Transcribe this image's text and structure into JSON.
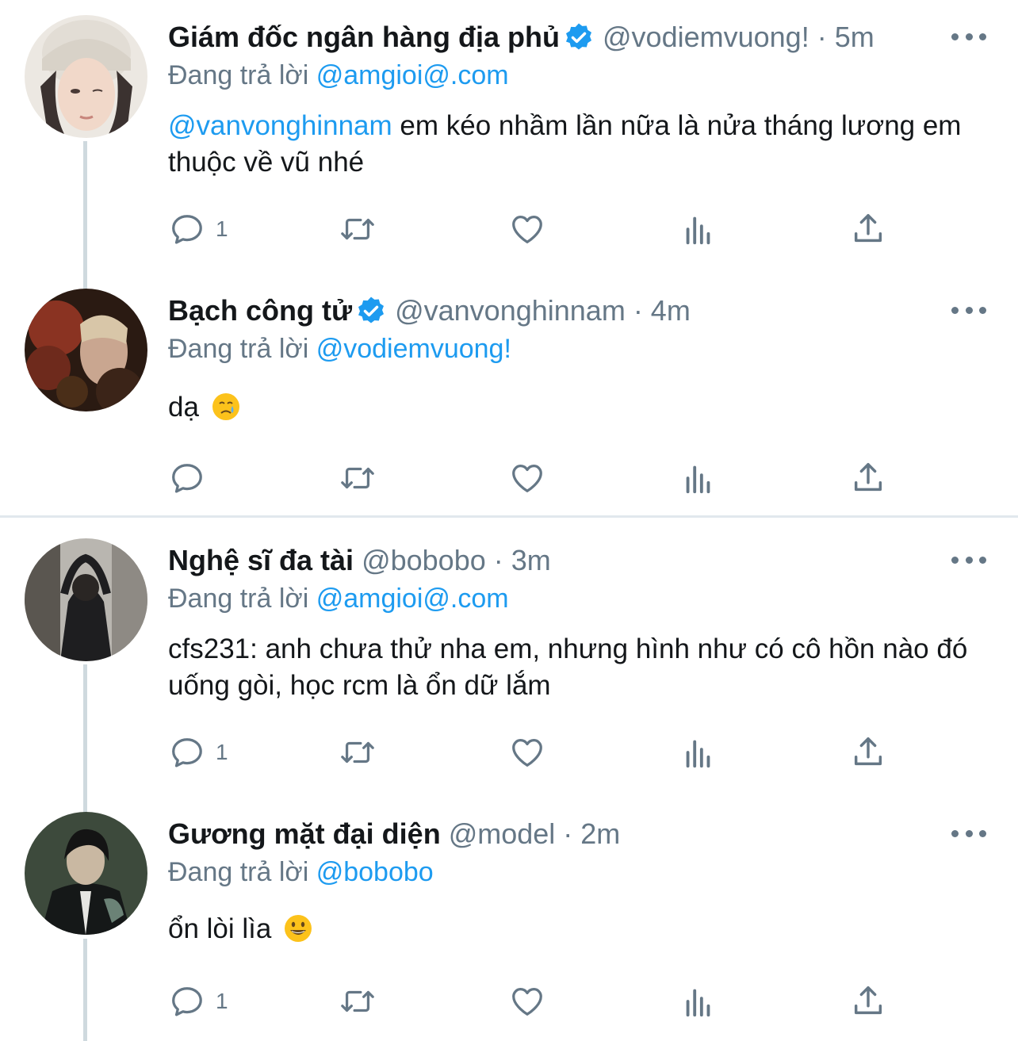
{
  "colors": {
    "accent": "#1d9bf0",
    "secondary_text": "#657786",
    "divider": "#e1e8ed",
    "thread_line": "#cfd9de"
  },
  "tweets": [
    {
      "name": "Giám đốc ngân hàng địa phủ",
      "handle": "@vodiemvuong! · 5m",
      "reply_prefix": "Đang trả lời ",
      "reply_to": "@amgioi@.com",
      "mention": "@vanvonghinnam",
      "text": " em kéo nhầm lần nữa là nửa tháng lương em thuộc về vũ nhé",
      "reply_count": "1"
    },
    {
      "name": "Bạch công tử",
      "handle": "@vanvonghinnam · 4m",
      "reply_prefix": "Đang trả lời ",
      "reply_to": "@vodiemvuong!",
      "text": "dạ",
      "emoji": "crying-face-emoji",
      "reply_count": ""
    },
    {
      "name": "Nghệ sĩ đa tài",
      "handle": "@bobobo · 3m",
      "reply_prefix": "Đang trả lời ",
      "reply_to": "@amgioi@.com",
      "text": "cfs231: anh chưa thử nha em, nhưng hình như có cô hồn nào đó uống gòi, học rcm là ổn dữ lắm",
      "reply_count": "1"
    },
    {
      "name": "Gương mặt đại diện",
      "handle": "@model · 2m",
      "reply_prefix": "Đang trả lời ",
      "reply_to": "@bobobo",
      "text": "ổn lòi lìa",
      "emoji": "grinning-face-emoji",
      "reply_count": "1"
    }
  ]
}
